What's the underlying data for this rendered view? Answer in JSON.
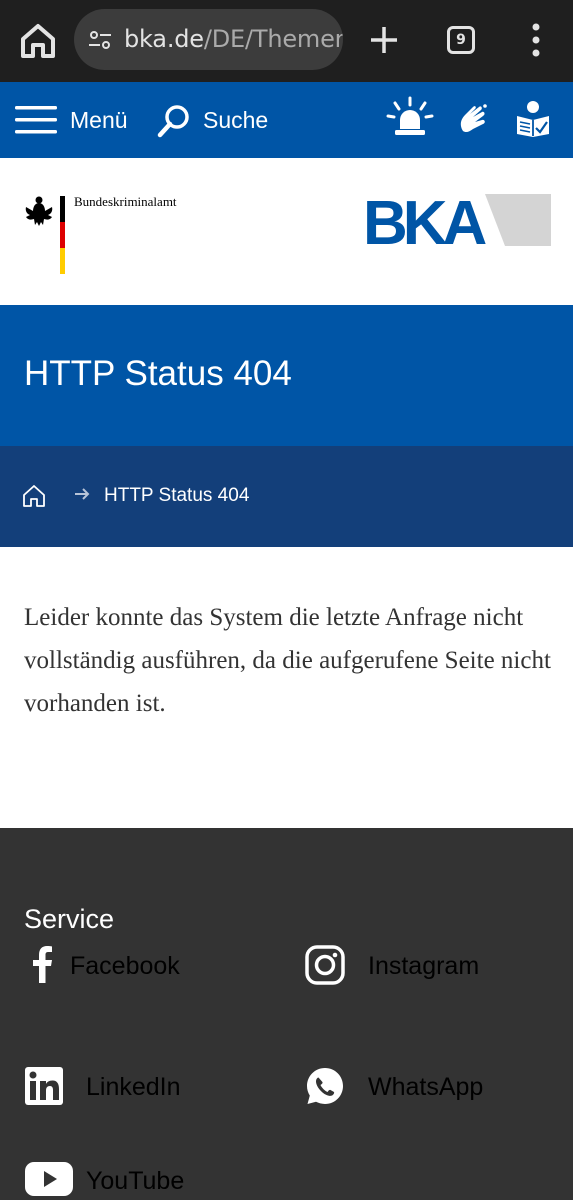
{
  "browser": {
    "url_host": "bka.de",
    "url_path": "/DE/Themen",
    "tab_count": "9"
  },
  "nav": {
    "menu_label": "Menü",
    "search_label": "Suche"
  },
  "header": {
    "agency_name": "Bundeskriminalamt",
    "logo_text": "BKA"
  },
  "title": "HTTP Status 404",
  "breadcrumb": {
    "current": "HTTP Status 404"
  },
  "content": {
    "message": "Leider konnte das System die letzte Anfrage nicht vollständig ausführen, da die aufgerufene Seite nicht vorhanden ist."
  },
  "footer": {
    "heading": "Service",
    "links": {
      "facebook": "Facebook",
      "instagram": "Instagram",
      "linkedin": "LinkedIn",
      "whatsapp": "WhatsApp",
      "youtube": "YouTube"
    }
  },
  "colors": {
    "brand_blue": "#0055a6",
    "breadcrumb_blue": "#133f7a",
    "footer_dark": "#333333"
  }
}
